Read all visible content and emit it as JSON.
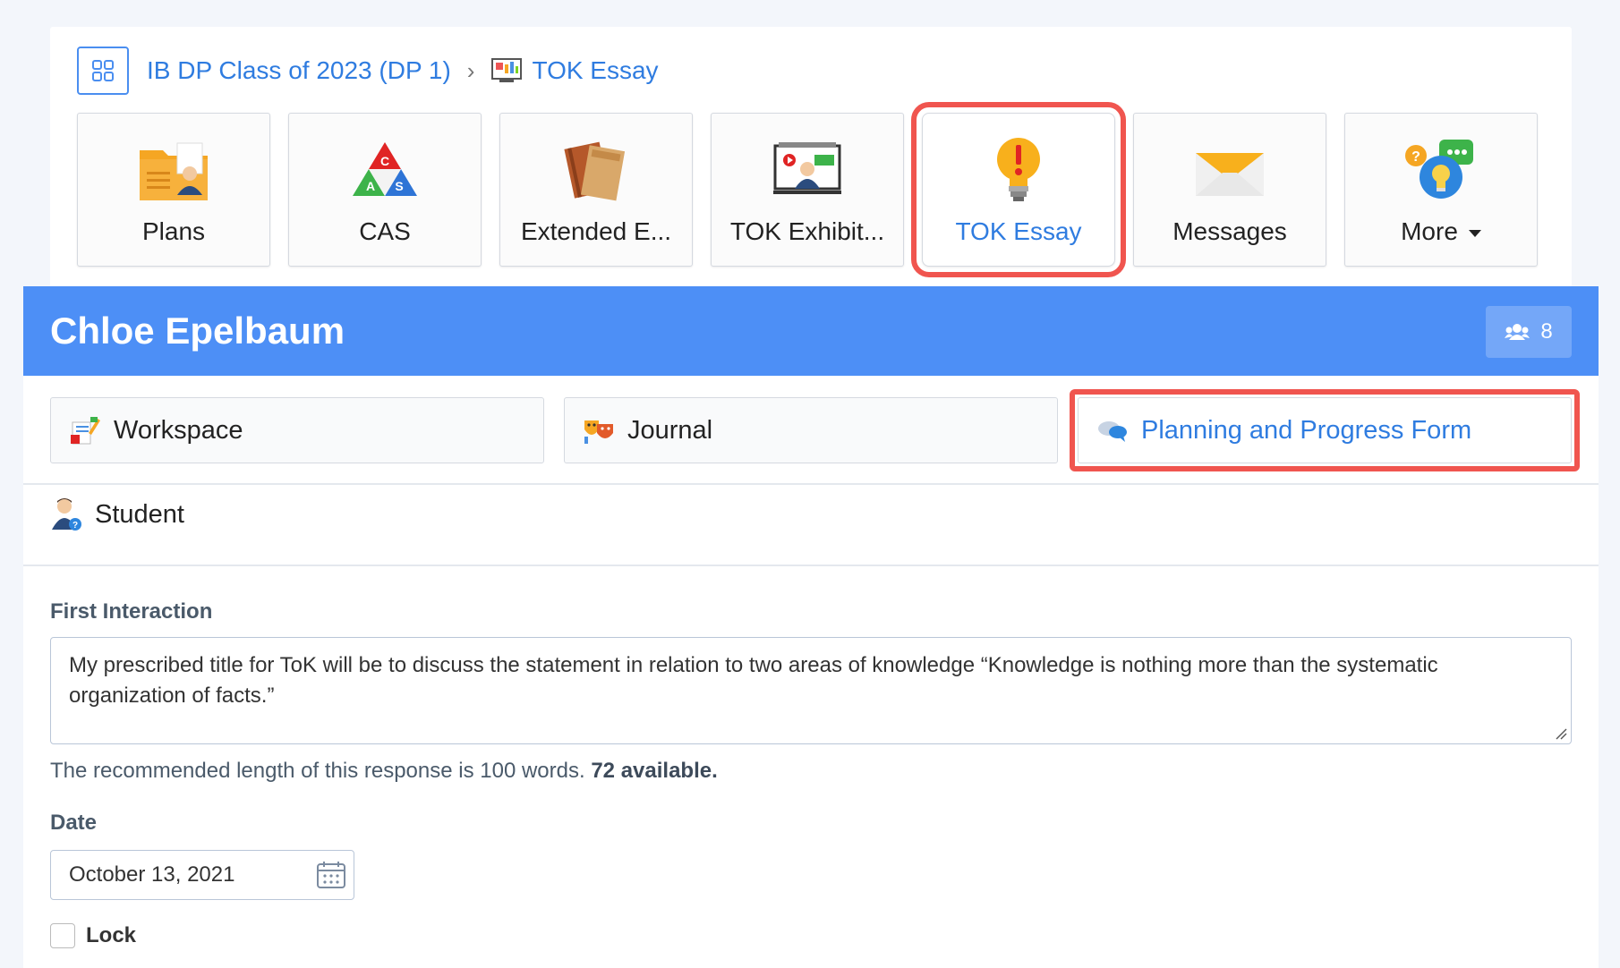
{
  "breadcrumb": {
    "class_name": "IB DP Class of 2023 (DP 1)",
    "current": "TOK Essay"
  },
  "tiles": [
    {
      "label": "Plans",
      "icon": "folder-person-icon",
      "active": false
    },
    {
      "label": "CAS",
      "icon": "cas-triangle-icon",
      "active": false
    },
    {
      "label": "Extended E...",
      "icon": "books-icon",
      "active": false
    },
    {
      "label": "TOK Exhibit...",
      "icon": "presentation-icon",
      "active": false
    },
    {
      "label": "TOK Essay",
      "icon": "lightbulb-icon",
      "active": true
    },
    {
      "label": "Messages",
      "icon": "envelope-icon",
      "active": false
    },
    {
      "label": "More",
      "icon": "help-bulb-icon",
      "active": false
    }
  ],
  "header": {
    "student_name": "Chloe Epelbaum",
    "member_count": "8"
  },
  "tabs": [
    {
      "label": "Workspace",
      "icon": "notes-pencil-icon"
    },
    {
      "label": "Journal",
      "icon": "theater-masks-icon"
    },
    {
      "label": "Planning and Progress Form",
      "icon": "chat-bubbles-icon"
    }
  ],
  "role_label": "Student",
  "form": {
    "first_interaction_label": "First Interaction",
    "first_interaction_value": "My prescribed title for ToK will be to discuss the statement in relation to two areas of knowledge “Knowledge is nothing more than the systematic organization of facts.”",
    "hint_text": "The recommended length of this response is 100 words.",
    "hint_available": "72 available.",
    "date_label": "Date",
    "date_value": "October 13, 2021",
    "lock_label": "Lock"
  },
  "colors": {
    "accent": "#2f7ce0",
    "banner": "#4d8ff6",
    "highlight": "#f0554f"
  }
}
